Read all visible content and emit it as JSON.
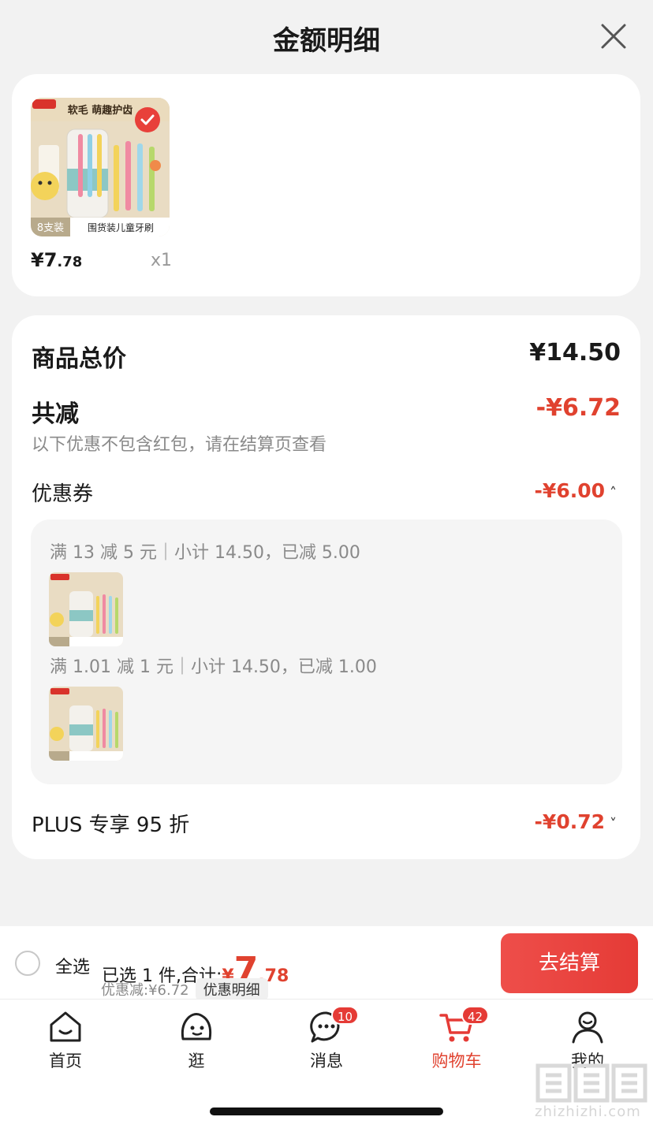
{
  "header": {
    "title": "金额明细",
    "close_icon": "close-icon"
  },
  "product": {
    "image_title": "围货装儿童牙刷",
    "image_top_text": "软毛 萌趣护齿",
    "image_tag": "8支装",
    "price_int": "¥7",
    "price_dec": ".78",
    "qty": "x1",
    "selected_icon": "check-circle-icon"
  },
  "summary": {
    "total_label": "商品总价",
    "total_value": "¥14.50",
    "reduce_label": "共减",
    "reduce_value": "-¥6.72",
    "note": "以下优惠不包含红包，请在结算页查看",
    "coupon_label": "优惠券",
    "coupon_value": "-¥6.00",
    "coupons": [
      {
        "text": "满 13 减 5 元｜小计 14.50，已减 5.00"
      },
      {
        "text": "满 1.01 减 1 元｜小计 14.50，已减 1.00"
      }
    ],
    "plus_label": "PLUS 专享 95 折",
    "plus_value": "-¥0.72"
  },
  "bottom_bar": {
    "select_all": "全选",
    "selected_text": "已选 1 件,合计:",
    "yen": "¥",
    "total_int": "7",
    "total_dec": ".78",
    "discount_text": "优惠减:¥6.72",
    "detail_tag": "优惠明细",
    "checkout": "去结算"
  },
  "tabs": [
    {
      "label": "首页",
      "icon": "home-icon"
    },
    {
      "label": "逛",
      "icon": "browse-icon"
    },
    {
      "label": "消息",
      "icon": "message-icon",
      "badge": "10"
    },
    {
      "label": "购物车",
      "icon": "cart-icon",
      "badge": "42",
      "active": true
    },
    {
      "label": "我的",
      "icon": "profile-icon"
    }
  ],
  "watermark": {
    "text": "zhizhizhi.com"
  },
  "colors": {
    "accent": "#e0422f",
    "button": "#e53b36",
    "background": "#f2f2f2"
  }
}
